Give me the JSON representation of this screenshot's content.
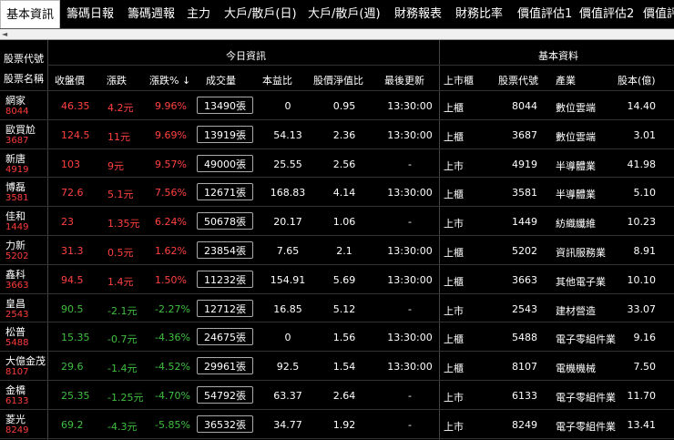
{
  "tabs": [
    "基本資訊",
    "籌碼日報",
    "籌碼週報",
    "主力",
    "大戶/散戶(日)",
    "大戶/散戶(週)",
    "財務報表",
    "財務比率",
    "價值評估1",
    "價值評估2",
    "價值評"
  ],
  "scroll_left_icon": "◄",
  "header": {
    "stock_code": "股票代號",
    "stock_name": "股票名稱",
    "group_today": "今日資訊",
    "group_basic": "基本資料",
    "cols": [
      "收盤價",
      "漲跌",
      "漲跌% ↓",
      "成交量",
      "本益比",
      "股價淨值比",
      "最後更新",
      "上市櫃",
      "股票代號",
      "產業",
      "股本(億)"
    ]
  },
  "rows": [
    {
      "name": "網家",
      "code": "8044",
      "close": "46.35",
      "change": "4.2元",
      "pct": "9.96%",
      "volume": "13490張",
      "pe": "0",
      "pb": "0.95",
      "time": "13:30:00",
      "market": "上櫃",
      "code2": "8044",
      "industry": "數位雲端",
      "capital": "14.40",
      "dir": "up"
    },
    {
      "name": "歐買尬",
      "code": "3687",
      "close": "124.5",
      "change": "11元",
      "pct": "9.69%",
      "volume": "13919張",
      "pe": "54.13",
      "pb": "2.36",
      "time": "13:30:00",
      "market": "上櫃",
      "code2": "3687",
      "industry": "數位雲端",
      "capital": "3.01",
      "dir": "up"
    },
    {
      "name": "新唐",
      "code": "4919",
      "close": "103",
      "change": "9元",
      "pct": "9.57%",
      "volume": "49000張",
      "pe": "25.55",
      "pb": "2.56",
      "time": "-",
      "market": "上市",
      "code2": "4919",
      "industry": "半導體業",
      "capital": "41.98",
      "dir": "up"
    },
    {
      "name": "博磊",
      "code": "3581",
      "close": "72.6",
      "change": "5.1元",
      "pct": "7.56%",
      "volume": "12671張",
      "pe": "168.83",
      "pb": "4.14",
      "time": "13:30:00",
      "market": "上櫃",
      "code2": "3581",
      "industry": "半導體業",
      "capital": "5.10",
      "dir": "up"
    },
    {
      "name": "佳和",
      "code": "1449",
      "close": "23",
      "change": "1.35元",
      "pct": "6.24%",
      "volume": "50678張",
      "pe": "20.17",
      "pb": "1.06",
      "time": "-",
      "market": "上市",
      "code2": "1449",
      "industry": "紡織纖維",
      "capital": "10.23",
      "dir": "up"
    },
    {
      "name": "力新",
      "code": "5202",
      "close": "31.3",
      "change": "0.5元",
      "pct": "1.62%",
      "volume": "23854張",
      "pe": "7.65",
      "pb": "2.1",
      "time": "13:30:00",
      "market": "上櫃",
      "code2": "5202",
      "industry": "資訊服務業",
      "capital": "8.91",
      "dir": "up"
    },
    {
      "name": "鑫科",
      "code": "3663",
      "close": "94.5",
      "change": "1.4元",
      "pct": "1.50%",
      "volume": "11232張",
      "pe": "154.91",
      "pb": "5.69",
      "time": "13:30:00",
      "market": "上櫃",
      "code2": "3663",
      "industry": "其他電子業",
      "capital": "10.10",
      "dir": "up"
    },
    {
      "name": "皇昌",
      "code": "2543",
      "close": "90.5",
      "change": "-2.1元",
      "pct": "-2.27%",
      "volume": "12712張",
      "pe": "16.85",
      "pb": "5.12",
      "time": "-",
      "market": "上市",
      "code2": "2543",
      "industry": "建材營造",
      "capital": "33.07",
      "dir": "down"
    },
    {
      "name": "松普",
      "code": "5488",
      "close": "15.35",
      "change": "-0.7元",
      "pct": "-4.36%",
      "volume": "24675張",
      "pe": "0",
      "pb": "1.56",
      "time": "13:30:00",
      "market": "上櫃",
      "code2": "5488",
      "industry": "電子零組件業",
      "capital": "9.16",
      "dir": "down"
    },
    {
      "name": "大億金茂",
      "code": "8107",
      "close": "29.6",
      "change": "-1.4元",
      "pct": "-4.52%",
      "volume": "29961張",
      "pe": "92.5",
      "pb": "1.54",
      "time": "13:30:00",
      "market": "上櫃",
      "code2": "8107",
      "industry": "電機機械",
      "capital": "7.50",
      "dir": "down"
    },
    {
      "name": "金橋",
      "code": "6133",
      "close": "25.35",
      "change": "-1.25元",
      "pct": "-4.70%",
      "volume": "54792張",
      "pe": "63.37",
      "pb": "2.64",
      "time": "-",
      "market": "上市",
      "code2": "6133",
      "industry": "電子零組件業",
      "capital": "11.70",
      "dir": "down"
    },
    {
      "name": "菱光",
      "code": "8249",
      "close": "69.2",
      "change": "-4.3元",
      "pct": "-5.85%",
      "volume": "36532張",
      "pe": "34.77",
      "pb": "1.92",
      "time": "-",
      "market": "上市",
      "code2": "8249",
      "industry": "電子零組件業",
      "capital": "13.41",
      "dir": "down"
    }
  ],
  "colors": {
    "up": "#ff4040",
    "down": "#3fbf3f",
    "code": "#ff3b3b"
  }
}
